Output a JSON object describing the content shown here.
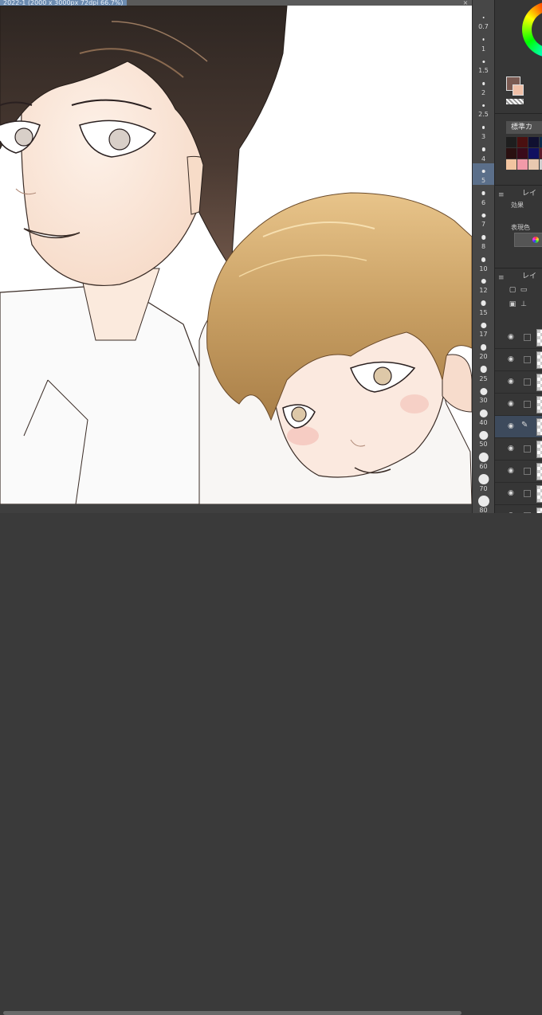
{
  "document": {
    "tab_title": "2022-1 (2000 x 3000px 72dpi 66.7%)",
    "close_label": "×"
  },
  "brush_sizes": [
    {
      "label": "0.7",
      "selected": false
    },
    {
      "label": "1",
      "selected": false
    },
    {
      "label": "1.5",
      "selected": false
    },
    {
      "label": "2",
      "selected": false
    },
    {
      "label": "2.5",
      "selected": false
    },
    {
      "label": "3",
      "selected": false
    },
    {
      "label": "4",
      "selected": false
    },
    {
      "label": "5",
      "selected": true
    },
    {
      "label": "6",
      "selected": false
    },
    {
      "label": "7",
      "selected": false
    },
    {
      "label": "8",
      "selected": false
    },
    {
      "label": "10",
      "selected": false
    },
    {
      "label": "12",
      "selected": false
    },
    {
      "label": "15",
      "selected": false
    },
    {
      "label": "17",
      "selected": false
    },
    {
      "label": "20",
      "selected": false
    },
    {
      "label": "25",
      "selected": false
    },
    {
      "label": "30",
      "selected": false
    },
    {
      "label": "40",
      "selected": false
    },
    {
      "label": "50",
      "selected": false
    },
    {
      "label": "60",
      "selected": false
    },
    {
      "label": "70",
      "selected": false
    },
    {
      "label": "80",
      "selected": false
    }
  ],
  "color_panel": {
    "main_color": "#7a5a52",
    "sub_color": "#f0c0a8"
  },
  "color_set_panel": {
    "dropdown_label": "標準カ",
    "swatches": [
      "#1e1e1e",
      "#4a1010",
      "#101030",
      "#0a2a4a",
      "#2a1010",
      "#3a0a1a",
      "#101060",
      "#5a1a2a",
      "#f2c4a0",
      "#f29aa8",
      "#e8c8b0",
      "#cfcfcf"
    ]
  },
  "layer_property": {
    "header": "レイ",
    "effect_label": "効果",
    "expression_color_label": "表現色"
  },
  "layer_panel": {
    "header": "レイ",
    "layer_count": 9,
    "active_layer_index": 4
  }
}
